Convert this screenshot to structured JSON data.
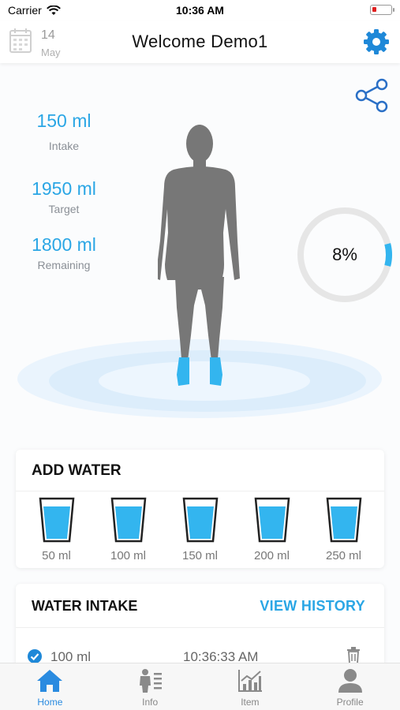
{
  "status_bar": {
    "carrier": "Carrier",
    "time": "10:36 AM"
  },
  "header": {
    "date_day": "14",
    "date_month": "May",
    "title": "Welcome Demo1",
    "icons": [
      "calendar-icon",
      "gear-icon"
    ]
  },
  "stats": [
    {
      "value": "150 ml",
      "label": "Intake"
    },
    {
      "value": "1950 ml",
      "label": "Target"
    },
    {
      "value": "1800 ml",
      "label": "Remaining"
    }
  ],
  "progress": {
    "label": "8%",
    "fraction": 0.08
  },
  "add_water": {
    "title": "ADD WATER",
    "options": [
      "50 ml",
      "100 ml",
      "150 ml",
      "200 ml",
      "250 ml"
    ]
  },
  "water_intake": {
    "title": "WATER INTAKE",
    "view_history": "VIEW HISTORY",
    "entries": [
      {
        "amount": "100 ml",
        "time": "10:36:33 AM"
      }
    ]
  },
  "tabs": [
    {
      "label": "Home",
      "icon": "home-icon"
    },
    {
      "label": "Info",
      "icon": "info-icon"
    },
    {
      "label": "Item",
      "icon": "chart-icon"
    },
    {
      "label": "Profile",
      "icon": "profile-icon"
    }
  ],
  "colors": {
    "accent": "#2aa6e5",
    "tab_active": "#2a8be0",
    "body": "#777777",
    "feet": "#33b5ef"
  }
}
